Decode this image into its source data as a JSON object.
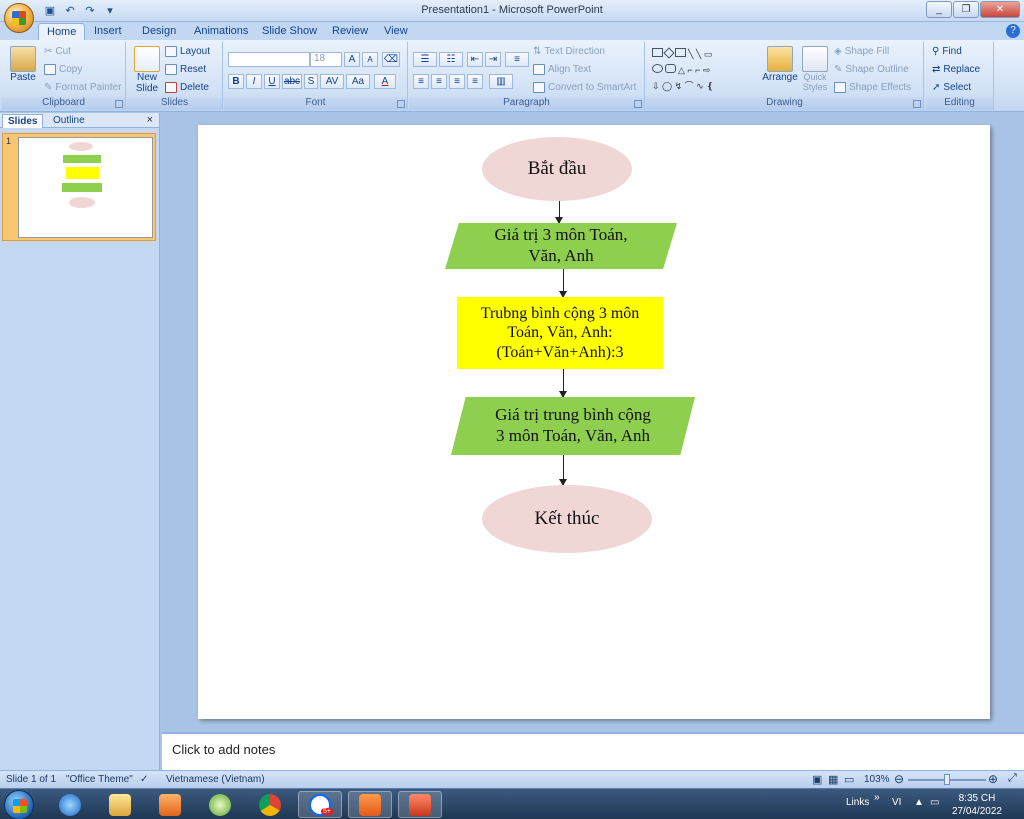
{
  "window": {
    "title": "Presentation1 - Microsoft PowerPoint",
    "min_icon": "minimize-icon",
    "max_icon": "restore-icon",
    "close_icon": "close-icon"
  },
  "tabs": [
    "Home",
    "Insert",
    "Design",
    "Animations",
    "Slide Show",
    "Review",
    "View"
  ],
  "ribbon": {
    "clipboard": {
      "paste": "Paste",
      "cut": "Cut",
      "copy": "Copy",
      "format_painter": "Format Painter",
      "label": "Clipboard"
    },
    "slides": {
      "new_slide_1": "New",
      "new_slide_2": "Slide",
      "layout": "Layout",
      "reset": "Reset",
      "delete": "Delete",
      "label": "Slides"
    },
    "font": {
      "font_size": "18",
      "bold": "B",
      "italic": "I",
      "underline": "U",
      "strike": "abc",
      "shadow": "S",
      "spacing": "AV",
      "case": "Aa",
      "color": "A",
      "grow": "A",
      "shrink": "A",
      "label": "Font"
    },
    "paragraph": {
      "text_direction": "Text Direction",
      "align_text": "Align Text",
      "convert": "Convert to SmartArt",
      "label": "Paragraph"
    },
    "drawing": {
      "arrange": "Arrange",
      "quick_styles_1": "Quick",
      "quick_styles_2": "Styles",
      "shape_fill": "Shape Fill",
      "shape_outline": "Shape Outline",
      "shape_effects": "Shape Effects",
      "label": "Drawing"
    },
    "editing": {
      "find": "Find",
      "replace": "Replace",
      "select": "Select",
      "label": "Editing"
    }
  },
  "left_panel": {
    "tab_slides": "Slides",
    "tab_outline": "Outline",
    "close": "×",
    "slide_number": "1"
  },
  "flowchart": {
    "start": "Bắt đầu",
    "input_1": "Giá trị 3 môn Toán,",
    "input_2": "Văn, Anh",
    "process_1": "Trubng bình cộng 3 môn",
    "process_2": "Toán, Văn, Anh:",
    "process_3": "(Toán+Văn+Anh):3",
    "output_1": "Giá trị trung bình cộng",
    "output_2": "3 môn Toán, Văn, Anh",
    "end": "Kết thúc",
    "colors": {
      "terminal": "#f1d6d6",
      "io": "#8fcf4f",
      "process": "#ffff00"
    }
  },
  "notes": {
    "placeholder": "Click to add notes"
  },
  "status": {
    "slide": "Slide 1 of 1",
    "theme": "\"Office Theme\"",
    "language": "Vietnamese (Vietnam)",
    "zoom": "103%"
  },
  "taskbar": {
    "links": "Links",
    "lang": "VI",
    "time": "8:35 CH",
    "date": "27/04/2022",
    "zalo_badge": "5+"
  }
}
